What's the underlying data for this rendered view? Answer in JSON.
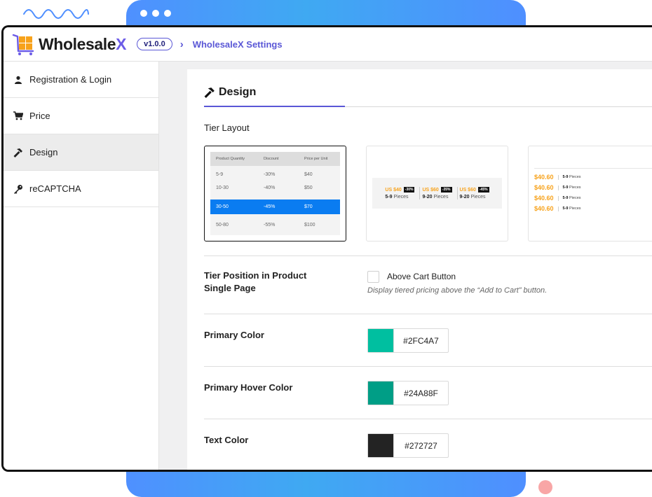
{
  "app": {
    "name_main": "Wholesale",
    "name_accent": "X",
    "version": "v1.0.0",
    "breadcrumb": "WholesaleX Settings"
  },
  "sidebar": {
    "items": [
      {
        "label": "Registration & Login",
        "icon": "user-icon"
      },
      {
        "label": "Price",
        "icon": "cart-icon"
      },
      {
        "label": "Design",
        "icon": "hammer-icon",
        "active": true
      },
      {
        "label": "reCAPTCHA",
        "icon": "key-icon"
      }
    ]
  },
  "design": {
    "title": "Design",
    "tier_layout_label": "Tier Layout",
    "layout1": {
      "headers": [
        "Product Quantity",
        "Discount",
        "Price per Unit"
      ],
      "rows": [
        [
          "5-9",
          "-30%",
          "$40"
        ],
        [
          "10-30",
          "-40%",
          "$50"
        ],
        [
          "30-50",
          "-45%",
          "$70"
        ],
        [
          "50-80",
          "-55%",
          "$100"
        ]
      ]
    },
    "layout2": {
      "items": [
        {
          "price": "US $40",
          "badge": "-30%",
          "qty": "5-9",
          "unit": "Pieces"
        },
        {
          "price": "US $60",
          "badge": "-35%",
          "qty": "9-20",
          "unit": "Pieces"
        },
        {
          "price": "US $60",
          "badge": "-45%",
          "qty": "9-20",
          "unit": "Pieces"
        }
      ]
    },
    "layout3": {
      "items": [
        {
          "price": "$40.60",
          "qty": "5-9",
          "unit": "Pieces"
        },
        {
          "price": "$40.60",
          "qty": "5-9",
          "unit": "Pieces"
        },
        {
          "price": "$40.60",
          "qty": "5-9",
          "unit": "Pieces"
        },
        {
          "price": "$40.60",
          "qty": "5-9",
          "unit": "Pieces"
        }
      ]
    },
    "tier_position": {
      "label_line1": "Tier Position in Product",
      "label_line2": "Single Page",
      "checkbox_label": "Above Cart Button",
      "hint": "Display tiered pricing above the “Add to Cart” button.",
      "checked": false
    },
    "primary_color": {
      "label": "Primary Color",
      "value": "#2FC4A7",
      "swatch": "#00bfa0"
    },
    "primary_hover_color": {
      "label": "Primary Hover Color",
      "value": "#24A88F",
      "swatch": "#009e86"
    },
    "text_color": {
      "label": "Text Color",
      "value": "#272727",
      "swatch": "#232323"
    }
  },
  "colors": {
    "accent": "#5a57d6",
    "highlight_row": "#0a7cf1",
    "price_orange": "#f7a21b"
  }
}
